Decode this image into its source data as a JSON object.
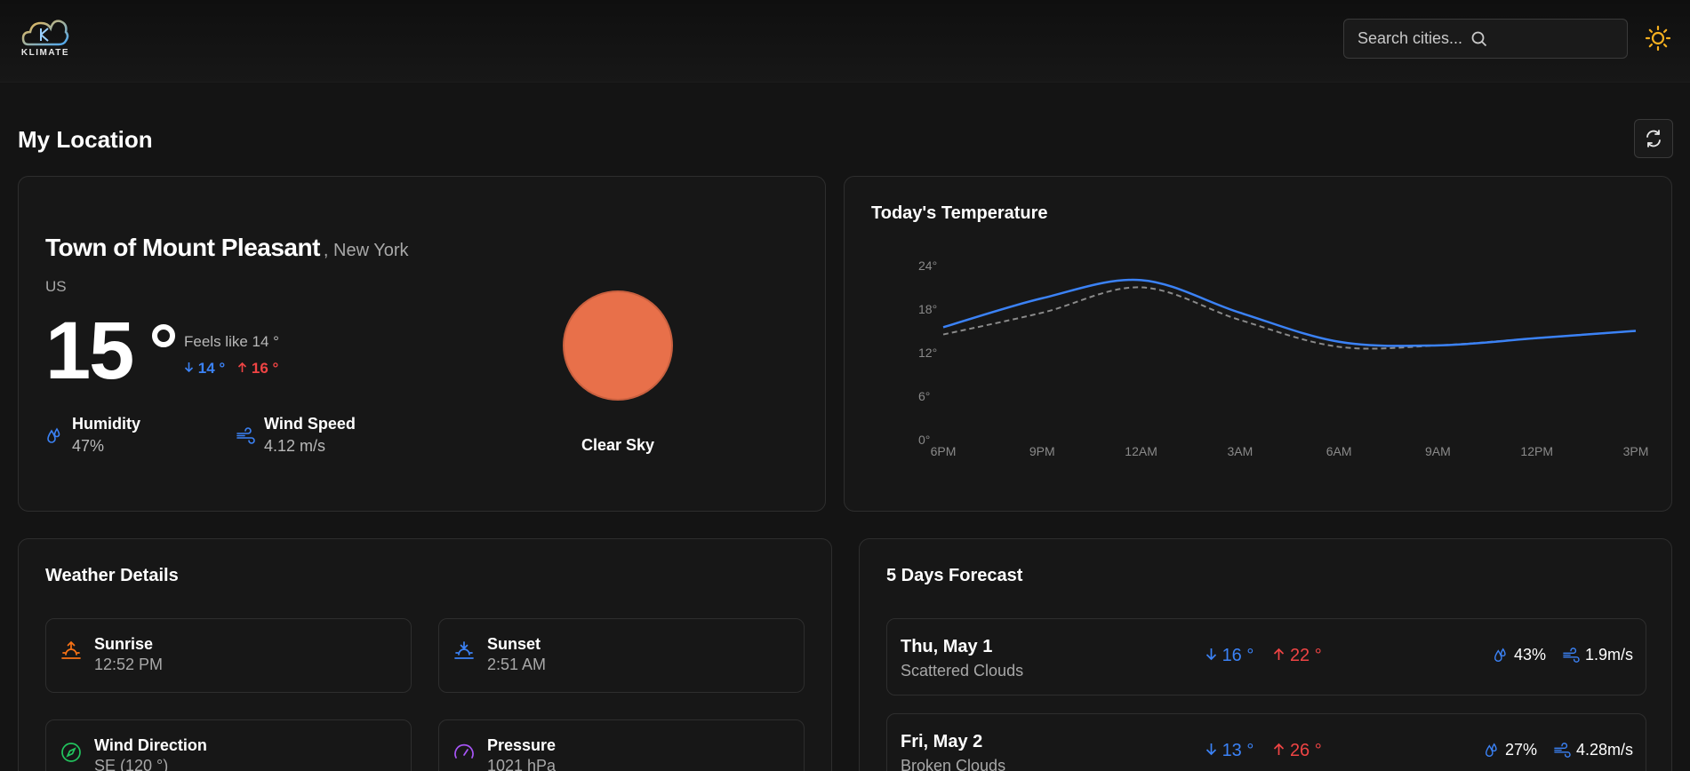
{
  "header": {
    "logo_text": "KLIMATE",
    "search_placeholder": "Search cities..."
  },
  "page": {
    "title": "My Location"
  },
  "current": {
    "city": "Town of Mount Pleasant",
    "state": ", New York",
    "country": "US",
    "temp": "15",
    "feels_like": "Feels like 14 °",
    "min": "14 °",
    "max": "16 °",
    "humidity_label": "Humidity",
    "humidity_value": "47%",
    "wind_label": "Wind Speed",
    "wind_value": "4.12 m/s",
    "condition": "Clear Sky",
    "condition_color": "#e8704a"
  },
  "temperature_card": {
    "title": "Today's Temperature"
  },
  "chart_data": {
    "type": "line",
    "categories": [
      "6PM",
      "9PM",
      "12AM",
      "3AM",
      "6AM",
      "9AM",
      "12PM",
      "3PM"
    ],
    "series": [
      {
        "values": [
          15.5,
          19.5,
          22,
          17.5,
          13.5,
          13.0,
          14.0,
          15.0
        ],
        "color": "#3b82f6",
        "style": "solid"
      },
      {
        "values": [
          14.5,
          17.5,
          21,
          16.5,
          12.8,
          13.0,
          14.0,
          15.0
        ],
        "color": "#8a8a8a",
        "style": "dashed"
      }
    ],
    "ylim": [
      0,
      24
    ],
    "yticks": [
      "0°",
      "6°",
      "12°",
      "18°",
      "24°"
    ],
    "grid": false
  },
  "details": {
    "title": "Weather Details",
    "items": [
      {
        "label": "Sunrise",
        "value": "12:52 PM"
      },
      {
        "label": "Sunset",
        "value": "2:51 AM"
      },
      {
        "label": "Wind Direction",
        "value": "SE (120 °)"
      },
      {
        "label": "Pressure",
        "value": "1021 hPa"
      }
    ]
  },
  "forecast": {
    "title": "5 Days Forecast",
    "days": [
      {
        "date": "Thu, May 1",
        "desc": "Scattered Clouds",
        "min": "16 °",
        "max": "22 °",
        "humidity": "43%",
        "wind": "1.9m/s"
      },
      {
        "date": "Fri, May 2",
        "desc": "Broken Clouds",
        "min": "13 °",
        "max": "26 °",
        "humidity": "27%",
        "wind": "4.28m/s"
      }
    ]
  }
}
